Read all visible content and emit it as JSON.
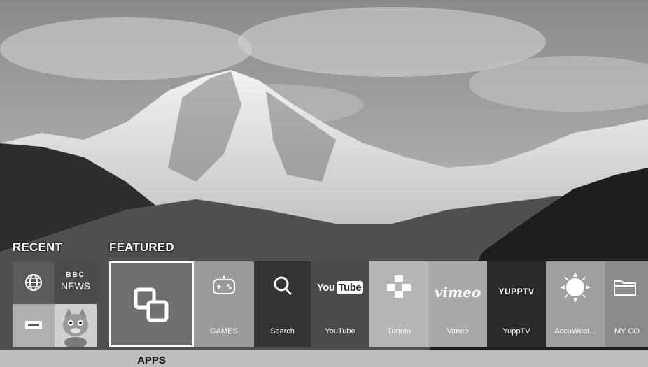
{
  "sections": {
    "recent": "RECENT",
    "featured": "FEATURED"
  },
  "recent": {
    "bbc_line1": "BBC",
    "bbc_line2": "NEWS"
  },
  "apps_label": "APPS",
  "tiles": [
    {
      "label": "GAMES",
      "icon": "gamepad-icon"
    },
    {
      "label": "Search",
      "icon": "search-icon"
    },
    {
      "label": "YouTube",
      "icon": "youtube-logo"
    },
    {
      "label": "TuneIn",
      "icon": "tunein-icon"
    },
    {
      "label": "Vimeo",
      "icon": "vimeo-logo"
    },
    {
      "label": "YuppTV",
      "icon": "yupptv-logo"
    },
    {
      "label": "AccuWeat...",
      "icon": "sun-icon"
    },
    {
      "label": "MY CO",
      "icon": "folder-icon"
    }
  ],
  "logos": {
    "youtube_you": "You",
    "youtube_tube": "Tube",
    "vimeo": "vimeo",
    "yupptv": "YUPPTV"
  }
}
